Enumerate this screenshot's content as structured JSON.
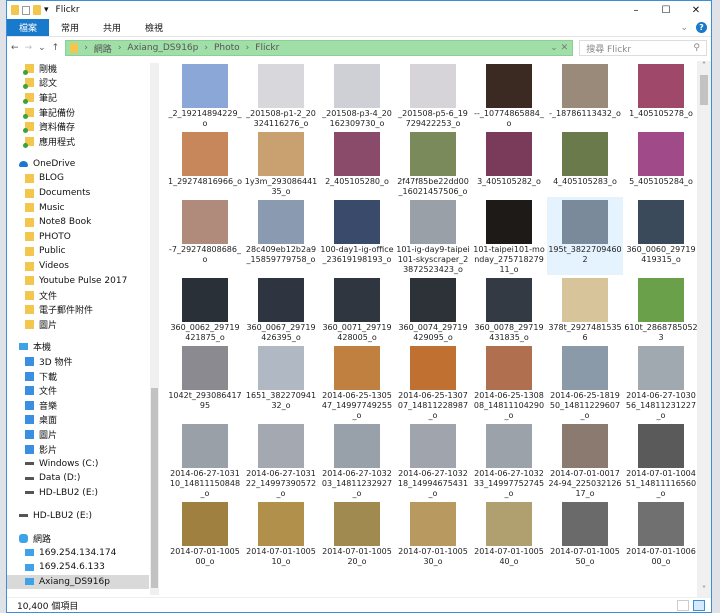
{
  "window": {
    "title": "Flickr"
  },
  "ribbon": {
    "tabs": [
      "檔案",
      "常用",
      "共用",
      "檢視"
    ]
  },
  "address": {
    "path": [
      "網路",
      "Axiang_DS916p",
      "Photo",
      "Flickr"
    ],
    "search_placeholder": "搜尋 Flickr"
  },
  "sidebar": {
    "items": [
      {
        "label": "剛機",
        "icon": "sync-folder",
        "level": "l2"
      },
      {
        "label": "認文",
        "icon": "sync-folder",
        "level": "l2"
      },
      {
        "label": "筆記",
        "icon": "sync-folder",
        "level": "l2"
      },
      {
        "label": "筆記備份",
        "icon": "sync-folder",
        "level": "l2"
      },
      {
        "label": "資料備存",
        "icon": "sync-folder",
        "level": "l2"
      },
      {
        "label": "應用程式",
        "icon": "sync-folder",
        "level": "l2"
      },
      {
        "label": "OneDrive",
        "icon": "cloud",
        "level": "l1",
        "gap": true
      },
      {
        "label": "BLOG",
        "icon": "folder",
        "level": "l2"
      },
      {
        "label": "Documents",
        "icon": "folder",
        "level": "l2"
      },
      {
        "label": "Music",
        "icon": "folder",
        "level": "l2"
      },
      {
        "label": "Note8 Book",
        "icon": "folder",
        "level": "l2"
      },
      {
        "label": "PHOTO",
        "icon": "folder",
        "level": "l2"
      },
      {
        "label": "Public",
        "icon": "folder",
        "level": "l2"
      },
      {
        "label": "Videos",
        "icon": "folder",
        "level": "l2"
      },
      {
        "label": "Youtube Pulse 2017",
        "icon": "folder",
        "level": "l2"
      },
      {
        "label": "文件",
        "icon": "folder",
        "level": "l2"
      },
      {
        "label": "電子郵件附件",
        "icon": "folder",
        "level": "l2"
      },
      {
        "label": "圖片",
        "icon": "folder",
        "level": "l2"
      },
      {
        "label": "本機",
        "icon": "pc",
        "level": "l1",
        "gap": true
      },
      {
        "label": "3D 物件",
        "icon": "3d-objects",
        "level": "l2"
      },
      {
        "label": "下載",
        "icon": "download",
        "level": "l2"
      },
      {
        "label": "文件",
        "icon": "document",
        "level": "l2"
      },
      {
        "label": "音樂",
        "icon": "music",
        "level": "l2"
      },
      {
        "label": "桌面",
        "icon": "desktop",
        "level": "l2"
      },
      {
        "label": "圖片",
        "icon": "pictures",
        "level": "l2"
      },
      {
        "label": "影片",
        "icon": "videos",
        "level": "l2"
      },
      {
        "label": "Windows (C:)",
        "icon": "drive",
        "level": "l2"
      },
      {
        "label": "Data (D:)",
        "icon": "drive",
        "level": "l2"
      },
      {
        "label": "HD-LBU2 (E:)",
        "icon": "drive",
        "level": "l2"
      },
      {
        "label": "HD-LBU2 (E:)",
        "icon": "drive",
        "level": "l1",
        "gap": true
      },
      {
        "label": "網路",
        "icon": "network",
        "level": "l1",
        "gap": true
      },
      {
        "label": "169.254.134.174",
        "icon": "pc",
        "level": "l2"
      },
      {
        "label": "169.254.6.133",
        "icon": "pc",
        "level": "l2"
      },
      {
        "label": "Axiang_DS916p",
        "icon": "pc",
        "level": "l2",
        "selected": true
      }
    ]
  },
  "files": [
    {
      "name": "_2_19214894229_o",
      "color": "#8aa7d8"
    },
    {
      "name": "_201508-p1-2_20324116276_o",
      "color": "#d8d8dc"
    },
    {
      "name": "_201508-p3-4_20162309730_o",
      "color": "#cfd0d6"
    },
    {
      "name": "_201508-p5-6_19729422253_o",
      "color": "#d6d4d8"
    },
    {
      "name": "--_10774865884_o",
      "color": "#3b2a22"
    },
    {
      "name": "-_18786113432_o",
      "color": "#9a8a7a"
    },
    {
      "name": "1_405105278_o",
      "color": "#a0486a"
    },
    {
      "name": "1_29274816966_o",
      "color": "#c8875a"
    },
    {
      "name": "1y3m_29308644135_o",
      "color": "#c9a070"
    },
    {
      "name": "2_405105280_o",
      "color": "#8a4a6a"
    },
    {
      "name": "2f47f85be22dd00_16021457506_o",
      "color": "#7a8a5a"
    },
    {
      "name": "3_405105282_o",
      "color": "#7a3a5a"
    },
    {
      "name": "4_405105283_o",
      "color": "#6a7a4a"
    },
    {
      "name": "5_405105284_o",
      "color": "#a04a8a"
    },
    {
      "name": "-7_29274808686_o",
      "color": "#b08a7a"
    },
    {
      "name": "28c409eb12b2a9_15859779758_o",
      "color": "#8a9ab0"
    },
    {
      "name": "100-day1-ig-office_23619198193_o",
      "color": "#3a4a6a"
    },
    {
      "name": "101-ig-day9-taipei101-skyscraper_23872523423_o",
      "color": "#9aa0a8"
    },
    {
      "name": "101-taipei101-monday_27571827911_o",
      "color": "#1e1a18"
    },
    {
      "name": "195t_38227094602",
      "color": "#7a8a9a",
      "selected": true
    },
    {
      "name": "360_0060_29719419315_o",
      "color": "#3a4a5a"
    },
    {
      "name": "360_0062_29719421875_o",
      "color": "#2a3038"
    },
    {
      "name": "360_0067_29719426395_o",
      "color": "#2e3440"
    },
    {
      "name": "360_0071_29719428005_o",
      "color": "#303640"
    },
    {
      "name": "360_0074_29719429095_o",
      "color": "#2c3238"
    },
    {
      "name": "360_0078_29719431835_o",
      "color": "#343a44"
    },
    {
      "name": "378t_29274815356",
      "color": "#d8c49a"
    },
    {
      "name": "610t_28687850523",
      "color": "#6aa04a"
    },
    {
      "name": "1042t_29308641795",
      "color": "#8a8a90"
    },
    {
      "name": "1651_38227094132_o",
      "color": "#b0b8c4"
    },
    {
      "name": "2014-06-25-130547_14997749255_o",
      "color": "#c08040"
    },
    {
      "name": "2014-06-25-130707_14811228987_o",
      "color": "#c07030"
    },
    {
      "name": "2014-06-25-130808_14811104290_o",
      "color": "#b07050"
    },
    {
      "name": "2014-06-25-181950_14811229607_o",
      "color": "#8a9aa8"
    },
    {
      "name": "2014-06-27-103056_14811231227_o",
      "color": "#a0a8b0"
    },
    {
      "name": "2014-06-27-103110_14811150848_o",
      "color": "#9aa0a8"
    },
    {
      "name": "2014-06-27-103122_14997390572_o",
      "color": "#a4a8b0"
    },
    {
      "name": "2014-06-27-103203_14811232927_o",
      "color": "#98a0aa"
    },
    {
      "name": "2014-06-27-103218_14994675431_o",
      "color": "#a0a4ac"
    },
    {
      "name": "2014-06-27-103233_14997752745_o",
      "color": "#9ca2aa"
    },
    {
      "name": "2014-07-01-001724-94_22503212617_o",
      "color": "#8a7a70"
    },
    {
      "name": "2014-07-01-100451_14811116560_o",
      "color": "#5a5a5a"
    },
    {
      "name": "2014-07-01-100500_o",
      "color": "#a08040"
    },
    {
      "name": "2014-07-01-100510_o",
      "color": "#b0904a"
    },
    {
      "name": "2014-07-01-100520_o",
      "color": "#a08a50"
    },
    {
      "name": "2014-07-01-100530_o",
      "color": "#b89a60"
    },
    {
      "name": "2014-07-01-100540_o",
      "color": "#b0a070"
    },
    {
      "name": "2014-07-01-100550_o",
      "color": "#6a6a6a"
    },
    {
      "name": "2014-07-01-100600_o",
      "color": "#707070"
    }
  ],
  "status": {
    "count": "10,400 個項目"
  }
}
